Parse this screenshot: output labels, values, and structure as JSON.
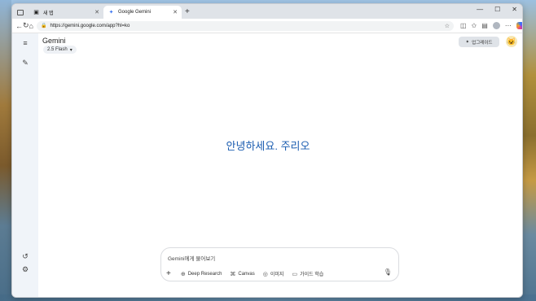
{
  "browser": {
    "tabs": [
      {
        "label": "새 탭",
        "icon": "page-icon",
        "active": false
      },
      {
        "label": "Google Gemini",
        "icon": "gemini-icon",
        "active": true
      }
    ],
    "new_tab_label": "+",
    "url": "https://gemini.google.com/app?hl=ko"
  },
  "app": {
    "brand": "Gemini",
    "model_label": "2.5 Flash",
    "upgrade_label": "업그레이드",
    "greeting": "안녕하세요. 주리오",
    "composer": {
      "placeholder": "Gemini에게 물어보기",
      "tools": [
        {
          "label": "Deep Research",
          "icon": "deep-research-icon"
        },
        {
          "label": "Canvas",
          "icon": "canvas-icon"
        },
        {
          "label": "이미지",
          "icon": "image-icon"
        },
        {
          "label": "가이드 학습",
          "icon": "guided-learning-icon"
        }
      ]
    }
  },
  "colors": {
    "greeting": "#1a5cb0",
    "rail_bg": "#f0f4f9"
  }
}
